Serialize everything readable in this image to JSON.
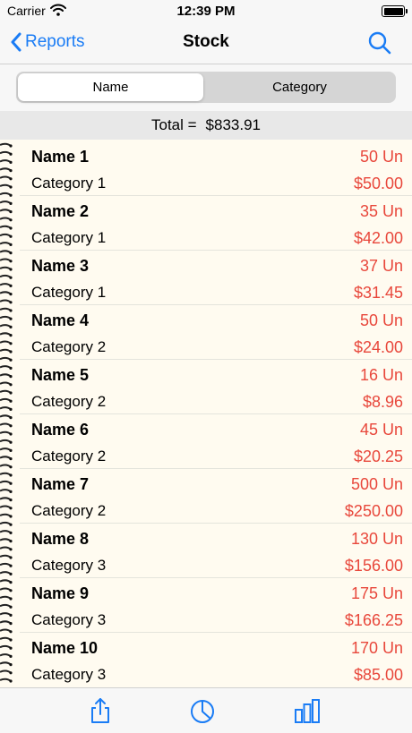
{
  "status_bar": {
    "carrier": "Carrier",
    "time": "12:39 PM"
  },
  "nav": {
    "back_label": "Reports",
    "title": "Stock"
  },
  "segments": {
    "selected": "Name",
    "other": "Category"
  },
  "total": {
    "label": "Total =",
    "amount": "$833.91"
  },
  "items": [
    {
      "name": "Name 1",
      "category": "Category 1",
      "units": "50 Un",
      "price": "$50.00"
    },
    {
      "name": "Name 2",
      "category": "Category 1",
      "units": "35 Un",
      "price": "$42.00"
    },
    {
      "name": "Name 3",
      "category": "Category 1",
      "units": "37 Un",
      "price": "$31.45"
    },
    {
      "name": "Name 4",
      "category": "Category 2",
      "units": "50 Un",
      "price": "$24.00"
    },
    {
      "name": "Name 5",
      "category": "Category 2",
      "units": "16 Un",
      "price": "$8.96"
    },
    {
      "name": "Name 6",
      "category": "Category 2",
      "units": "45 Un",
      "price": "$20.25"
    },
    {
      "name": "Name 7",
      "category": "Category 2",
      "units": "500 Un",
      "price": "$250.00"
    },
    {
      "name": "Name 8",
      "category": "Category 3",
      "units": "130 Un",
      "price": "$156.00"
    },
    {
      "name": "Name 9",
      "category": "Category 3",
      "units": "175 Un",
      "price": "$166.25"
    },
    {
      "name": "Name 10",
      "category": "Category 3",
      "units": "170 Un",
      "price": "$85.00"
    }
  ],
  "toolbar": {
    "icons": [
      "share-icon",
      "pie-chart-icon",
      "bar-chart-icon"
    ]
  },
  "colors": {
    "accent": "#1a7cf5",
    "value_red": "#e8473b",
    "paper": "#fffbf0"
  }
}
